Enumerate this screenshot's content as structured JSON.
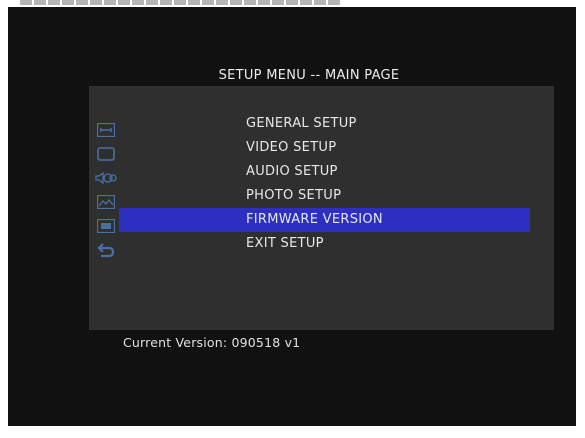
{
  "header": {
    "title": "SETUP MENU -- MAIN PAGE"
  },
  "menu": {
    "items": [
      {
        "label": "GENERAL SETUP",
        "icon": "wrench-icon",
        "selected": false
      },
      {
        "label": "VIDEO SETUP",
        "icon": "monitor-icon",
        "selected": false
      },
      {
        "label": "AUDIO SETUP",
        "icon": "speaker-icon",
        "selected": false
      },
      {
        "label": "PHOTO SETUP",
        "icon": "photo-icon",
        "selected": false
      },
      {
        "label": "FIRMWARE VERSION",
        "icon": "chip-icon",
        "selected": true
      },
      {
        "label": "EXIT SETUP",
        "icon": "return-icon",
        "selected": false
      }
    ]
  },
  "footer": {
    "version_text": "Current Version: 090518 v1"
  },
  "colors": {
    "screen_bg": "#111111",
    "panel_bg": "#2f2f2f",
    "highlight": "#2c2fc0",
    "icon": "#4a6fa5",
    "text": "#e8e8e8"
  }
}
